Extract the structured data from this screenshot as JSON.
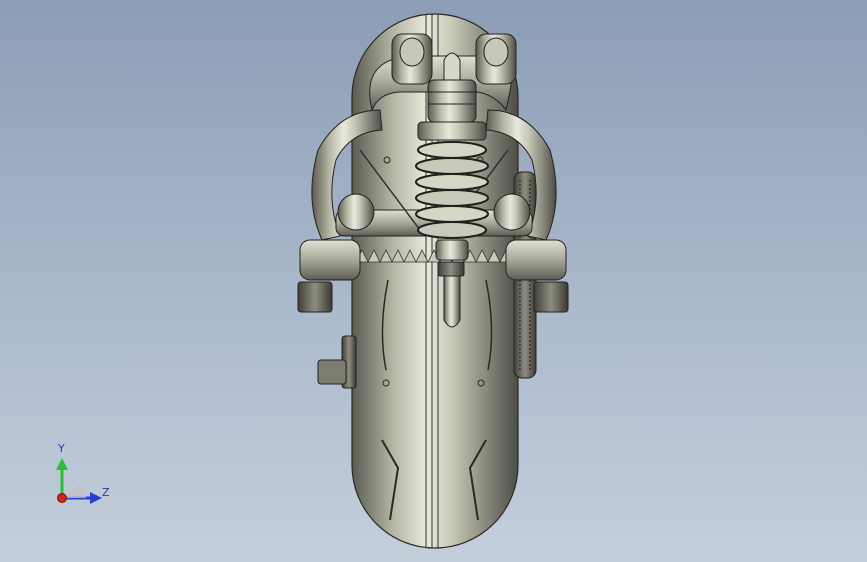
{
  "viewport": {
    "background_top": "#8c9db6",
    "background_bottom": "#c5cfdc",
    "model": "motorcycle-rear-wheel-and-suspension-assembly"
  },
  "triad": {
    "y_label": "Y",
    "z_label": "Z",
    "x_color": "#d42020",
    "y_color": "#2cbf3a",
    "z_color": "#2b3fcf"
  }
}
